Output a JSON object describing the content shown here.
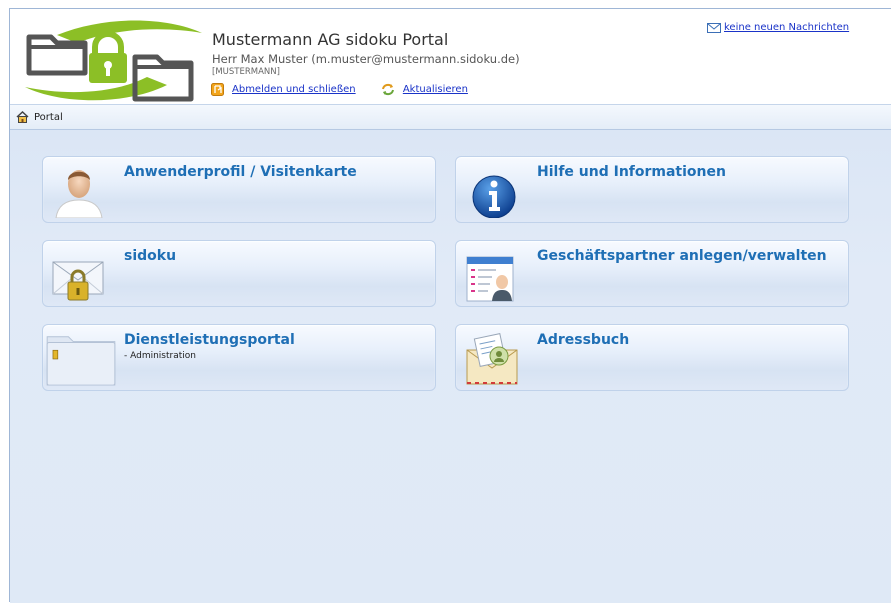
{
  "header": {
    "title": "Mustermann AG sidoku Portal",
    "user_line": "Herr Max Muster (m.muster@mustermann.sidoku.de)",
    "user_code": "[MUSTERMANN]",
    "logout_label": "Abmelden und schließen",
    "refresh_label": "Aktualisieren",
    "messages_label": "keine neuen Nachrichten"
  },
  "breadcrumb": {
    "home_label": "Portal"
  },
  "tiles": [
    {
      "title": "Anwenderprofil / Visitenkarte",
      "subtitle": "",
      "icon": "user-profile-icon"
    },
    {
      "title": "Hilfe und Informationen",
      "subtitle": "",
      "icon": "info-icon"
    },
    {
      "title": "sidoku",
      "subtitle": "",
      "icon": "locked-mail-icon"
    },
    {
      "title": "Geschäftspartner anlegen/verwalten",
      "subtitle": "",
      "icon": "business-partner-icon"
    },
    {
      "title": "Dienstleistungsportal",
      "subtitle": "- Administration",
      "icon": "folder-icon"
    },
    {
      "title": "Adressbuch",
      "subtitle": "",
      "icon": "address-book-icon"
    }
  ],
  "colors": {
    "accent": "#1f6fb5",
    "link": "#1a33c8",
    "logo_green": "#8cbf26",
    "background": "#dfe9f6"
  }
}
